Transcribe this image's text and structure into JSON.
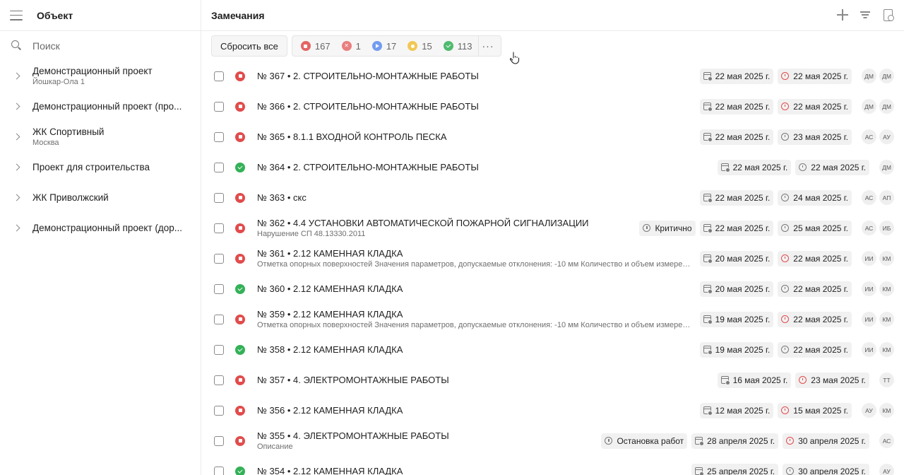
{
  "sidebar": {
    "title": "Объект",
    "search_placeholder": "Поиск",
    "projects": [
      {
        "name": "Демонстрационный проект",
        "sub": "Йошкар-Ола 1"
      },
      {
        "name": "Демонстрационный проект (про...",
        "sub": ""
      },
      {
        "name": "ЖК Спортивный",
        "sub": "Москва"
      },
      {
        "name": "Проект для строительства",
        "sub": ""
      },
      {
        "name": "ЖК Приволжский",
        "sub": ""
      },
      {
        "name": "Демонстрационный проект (дор...",
        "sub": ""
      }
    ]
  },
  "main": {
    "title": "Замечания",
    "reset_label": "Сбросить все",
    "more_label": "···",
    "status_counts": [
      {
        "icon": "red-stop-status",
        "count": "167"
      },
      {
        "icon": "red-x-status",
        "count": "1"
      },
      {
        "icon": "blue-play-status",
        "count": "17"
      },
      {
        "icon": "yellow-status",
        "count": "15"
      },
      {
        "icon": "green-check-status",
        "count": "113"
      }
    ]
  },
  "issues": [
    {
      "title": "№ 367 • 2. СТРОИТЕЛЬНО-МОНТАЖНЫЕ РАБОТЫ",
      "sub": "",
      "status": "red",
      "tag": "",
      "created": "22 мая 2025 г.",
      "due": "22 мая 2025 г.",
      "overdue": true,
      "avatars": [
        "ДМ",
        "ДМ"
      ]
    },
    {
      "title": "№ 366 • 2. СТРОИТЕЛЬНО-МОНТАЖНЫЕ РАБОТЫ",
      "sub": "",
      "status": "red",
      "tag": "",
      "created": "22 мая 2025 г.",
      "due": "22 мая 2025 г.",
      "overdue": true,
      "avatars": [
        "ДМ",
        "ДМ"
      ]
    },
    {
      "title": "№ 365 • 8.1.1 ВХОДНОЙ КОНТРОЛЬ ПЕСКА",
      "sub": "",
      "status": "red",
      "tag": "",
      "created": "22 мая 2025 г.",
      "due": "23 мая 2025 г.",
      "overdue": false,
      "avatars": [
        "АС",
        "АУ"
      ]
    },
    {
      "title": "№ 364 • 2. СТРОИТЕЛЬНО-МОНТАЖНЫЕ РАБОТЫ",
      "sub": "",
      "status": "green",
      "tag": "",
      "created": "22 мая 2025 г.",
      "due": "22 мая 2025 г.",
      "overdue": false,
      "avatars": [
        "ДМ"
      ]
    },
    {
      "title": "№ 363 • скс",
      "sub": "",
      "status": "red",
      "tag": "",
      "created": "22 мая 2025 г.",
      "due": "24 мая 2025 г.",
      "overdue": false,
      "avatars": [
        "АС",
        "АП"
      ]
    },
    {
      "title": "№ 362 • 4.4 УСТАНОВКИ АВТОМАТИЧЕСКОЙ ПОЖАРНОЙ СИГНАЛИЗАЦИИ",
      "sub": "Нарушение СП 48.13330.2011",
      "status": "red",
      "tag": "Критично",
      "created": "22 мая 2025 г.",
      "due": "25 мая 2025 г.",
      "overdue": false,
      "avatars": [
        "АС",
        "ИБ"
      ]
    },
    {
      "title": "№ 361 • 2.12 КАМЕННАЯ КЛАДКА",
      "sub": "Отметка опорных поверхностей Значения параметров, допускаемые отклонения: -10 мм Количество и объем измерений",
      "status": "red",
      "tag": "",
      "created": "20 мая 2025 г.",
      "due": "22 мая 2025 г.",
      "overdue": true,
      "avatars": [
        "ИИ",
        "КМ"
      ]
    },
    {
      "title": "№ 360 • 2.12 КАМЕННАЯ КЛАДКА",
      "sub": "",
      "status": "green",
      "tag": "",
      "created": "20 мая 2025 г.",
      "due": "22 мая 2025 г.",
      "overdue": false,
      "avatars": [
        "ИИ",
        "КМ"
      ]
    },
    {
      "title": "№ 359 • 2.12 КАМЕННАЯ КЛАДКА",
      "sub": "Отметка опорных поверхностей Значения параметров, допускаемые отклонения: -10 мм Количество и объем измерений",
      "status": "red",
      "tag": "",
      "created": "19 мая 2025 г.",
      "due": "22 мая 2025 г.",
      "overdue": true,
      "avatars": [
        "ИИ",
        "КМ"
      ]
    },
    {
      "title": "№ 358 • 2.12 КАМЕННАЯ КЛАДКА",
      "sub": "",
      "status": "green",
      "tag": "",
      "created": "19 мая 2025 г.",
      "due": "22 мая 2025 г.",
      "overdue": false,
      "avatars": [
        "ИИ",
        "КМ"
      ]
    },
    {
      "title": "№ 357 • 4. ЭЛЕКТРОМОНТАЖНЫЕ РАБОТЫ",
      "sub": "",
      "status": "red",
      "tag": "",
      "created": "16 мая 2025 г.",
      "due": "23 мая 2025 г.",
      "overdue": true,
      "avatars": [
        "ТТ"
      ]
    },
    {
      "title": "№ 356 • 2.12 КАМЕННАЯ КЛАДКА",
      "sub": "",
      "status": "red",
      "tag": "",
      "created": "12 мая 2025 г.",
      "due": "15 мая 2025 г.",
      "overdue": true,
      "avatars": [
        "АУ",
        "КМ"
      ]
    },
    {
      "title": "№ 355 • 4. ЭЛЕКТРОМОНТАЖНЫЕ РАБОТЫ",
      "sub": "Описание",
      "status": "red",
      "tag": "Остановка работ",
      "created": "28 апреля 2025 г.",
      "due": "30 апреля 2025 г.",
      "overdue": true,
      "avatars": [
        "АС"
      ]
    },
    {
      "title": "№ 354 • 2.12 КАМЕННАЯ КЛАДКА",
      "sub": "",
      "status": "green",
      "tag": "",
      "created": "25 апреля 2025 г.",
      "due": "30 апреля 2025 г.",
      "overdue": false,
      "avatars": [
        "АУ"
      ]
    }
  ]
}
